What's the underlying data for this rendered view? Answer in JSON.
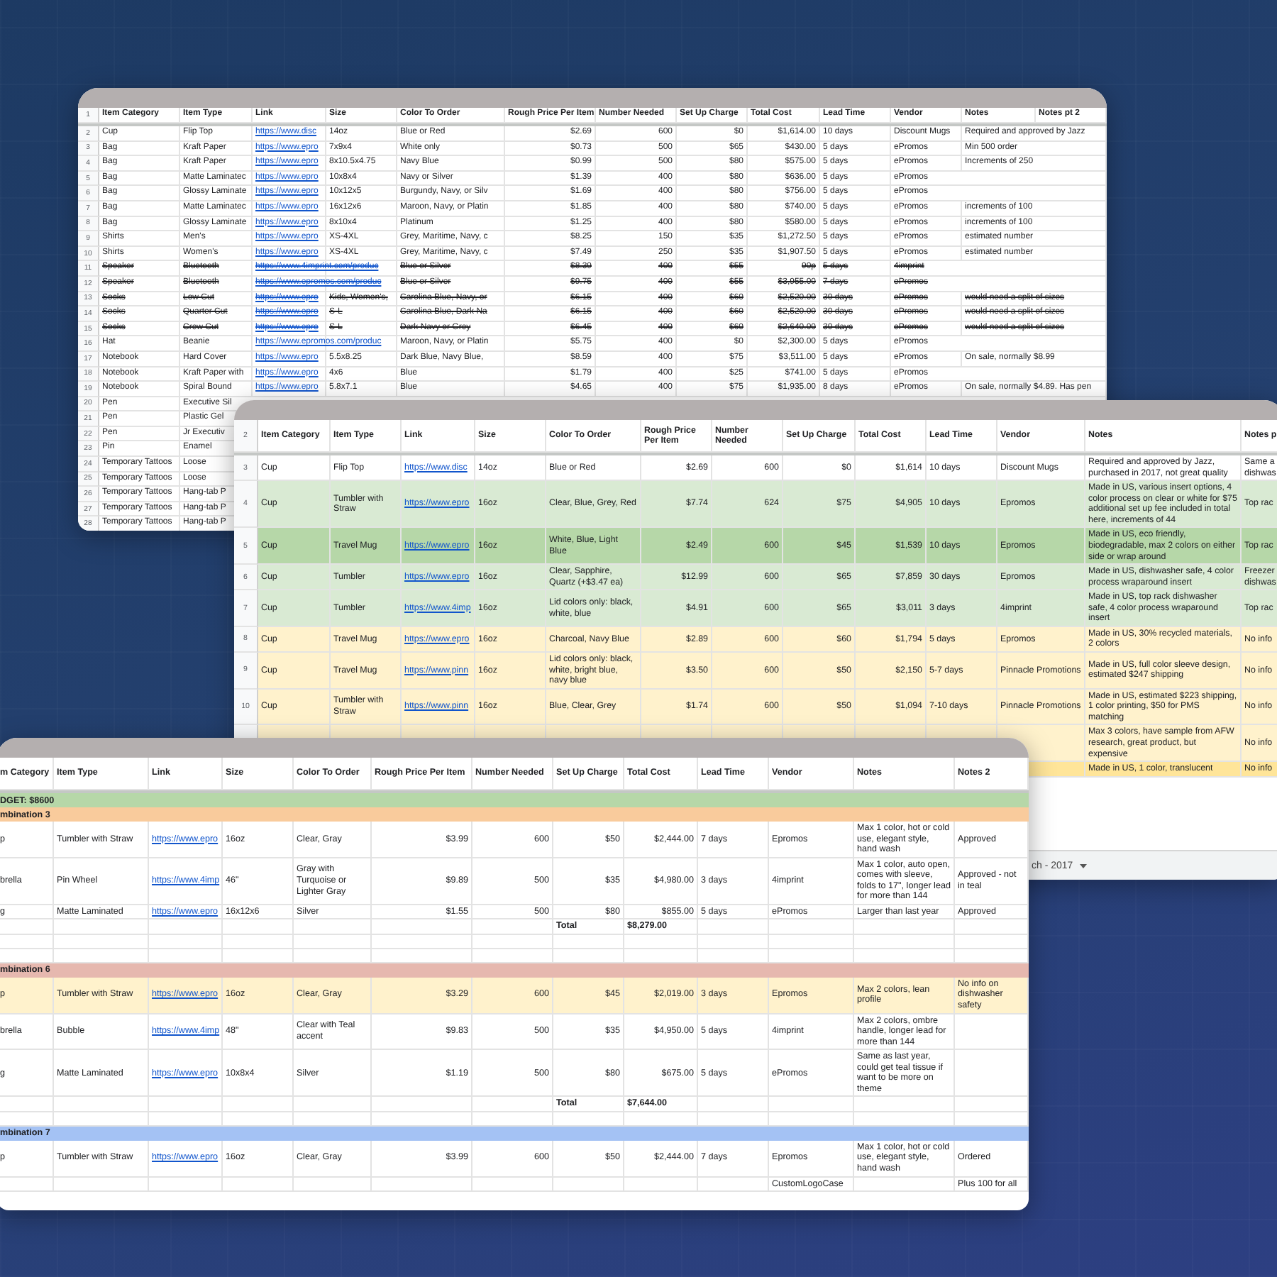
{
  "sheets": [
    {
      "header_row_number": "1",
      "columns": [
        "Item Category",
        "Item Type",
        "Link",
        "Size",
        "Color To Order",
        "Rough Price Per Item",
        "Number Needed",
        "Set Up Charge",
        "Total Cost",
        "Lead Time",
        "Vendor",
        "Notes",
        "Notes pt 2"
      ],
      "rows": [
        {
          "kind": "item",
          "n": "2",
          "struck": false,
          "cells": [
            "Cup",
            "Flip Top",
            "https://www.disc",
            "14oz",
            "Blue or Red",
            "$2.69",
            "600",
            "$0",
            "$1,614.00",
            "10 days",
            "Discount Mugs",
            "Required and approved by Jazz"
          ]
        },
        {
          "kind": "item",
          "n": "3",
          "struck": false,
          "cells": [
            "Bag",
            "Kraft Paper",
            "https://www.epro",
            "7x9x4",
            "White only",
            "$0.73",
            "500",
            "$65",
            "$430.00",
            "5 days",
            "ePromos",
            "Min 500 order"
          ]
        },
        {
          "kind": "item",
          "n": "4",
          "struck": false,
          "cells": [
            "Bag",
            "Kraft Paper",
            "https://www.epro",
            "8x10.5x4.75",
            "Navy Blue",
            "$0.99",
            "500",
            "$80",
            "$575.00",
            "5 days",
            "ePromos",
            "Increments of 250"
          ]
        },
        {
          "kind": "item",
          "n": "5",
          "struck": false,
          "cells": [
            "Bag",
            "Matte Laminatec",
            "https://www.epro",
            "10x8x4",
            "Navy or Silver",
            "$1.39",
            "400",
            "$80",
            "$636.00",
            "5 days",
            "ePromos"
          ]
        },
        {
          "kind": "item",
          "n": "6",
          "struck": false,
          "cells": [
            "Bag",
            "Glossy Laminate",
            "https://www.epro",
            "10x12x5",
            "Burgundy, Navy, or Silv",
            "$1.69",
            "400",
            "$80",
            "$756.00",
            "5 days",
            "ePromos"
          ]
        },
        {
          "kind": "item",
          "n": "7",
          "struck": false,
          "cells": [
            "Bag",
            "Matte Laminatec",
            "https://www.epro",
            "16x12x6",
            "Maroon, Navy, or Platin",
            "$1.85",
            "400",
            "$80",
            "$740.00",
            "5 days",
            "ePromos",
            "increments of 100"
          ]
        },
        {
          "kind": "item",
          "n": "8",
          "struck": false,
          "cells": [
            "Bag",
            "Glossy Laminate",
            "https://www.epro",
            "8x10x4",
            "Platinum",
            "$1.25",
            "400",
            "$80",
            "$580.00",
            "5 days",
            "ePromos",
            "increments of 100"
          ]
        },
        {
          "kind": "item",
          "n": "9",
          "struck": false,
          "cells": [
            "Shirts",
            "Men's",
            "https://www.epro",
            "XS-4XL",
            "Grey, Maritime, Navy, c",
            "$8.25",
            "150",
            "$35",
            "$1,272.50",
            "5 days",
            "ePromos",
            "estimated number"
          ]
        },
        {
          "kind": "item",
          "n": "10",
          "struck": false,
          "cells": [
            "Shirts",
            "Women's",
            "https://www.epro",
            "XS-4XL",
            "Grey, Maritime, Navy, c",
            "$7.49",
            "250",
            "$35",
            "$1,907.50",
            "5 days",
            "ePromos",
            "estimated number"
          ]
        },
        {
          "kind": "item",
          "n": "11",
          "struck": true,
          "cells": [
            "Speaker",
            "Bluetooth",
            "https://www.4imprint.com/produc",
            {
              "kind": "empty"
            },
            "Blue or Silver",
            "$8.39",
            "400",
            "$55",
            "90p",
            "5 days",
            "4imprint"
          ]
        },
        {
          "kind": "item",
          "n": "12",
          "struck": true,
          "cells": [
            "Speaker",
            "Bluetooth",
            "https://www.epromos.com/produc",
            {
              "kind": "empty"
            },
            "Blue or Silver",
            "$9.75",
            "400",
            "$55",
            "$3,955.00",
            "7 days",
            "ePromos"
          ]
        },
        {
          "kind": "item",
          "n": "13",
          "struck": true,
          "cells": [
            "Socks",
            "Low Cut",
            "https://www.epro",
            "Kids, Women's,",
            "Carolina Blue, Navy, or",
            "$6.15",
            "400",
            "$60",
            "$2,520.00",
            "30 days",
            "ePromos",
            "would need a split of sizes"
          ]
        },
        {
          "kind": "item",
          "n": "14",
          "struck": true,
          "cells": [
            "Socks",
            "Quarter Cut",
            "https://www.epro",
            "S-L",
            "Carolina Blue, Dark Na",
            "$6.15",
            "400",
            "$60",
            "$2,520.00",
            "30 days",
            "ePromos",
            "would need a split of sizes"
          ]
        },
        {
          "kind": "item",
          "n": "15",
          "struck": true,
          "cells": [
            "Socks",
            "Crew Cut",
            "https://www.epro",
            "S-L",
            "Dark Navy or Grey",
            "$6.45",
            "400",
            "$60",
            "$2,640.00",
            "30 days",
            "ePromos",
            "would need a split of sizes"
          ]
        },
        {
          "kind": "item",
          "n": "16",
          "struck": false,
          "cells": [
            "Hat",
            "Beanie",
            "https://www.epromos.com/produc",
            {
              "kind": "empty"
            },
            "Maroon, Navy, or Platin",
            "$5.75",
            "400",
            "$0",
            "$2,300.00",
            "5 days",
            "ePromos"
          ]
        },
        {
          "kind": "item",
          "n": "17",
          "struck": false,
          "cells": [
            "Notebook",
            "Hard Cover",
            "https://www.epro",
            "5.5x8.25",
            "Dark Blue, Navy Blue,",
            "$8.59",
            "400",
            "$75",
            "$3,511.00",
            "5 days",
            "ePromos",
            "On sale, normally $8.99"
          ]
        },
        {
          "kind": "item",
          "n": "18",
          "struck": false,
          "cells": [
            "Notebook",
            "Kraft Paper with",
            "https://www.epro",
            "4x6",
            "Blue",
            "$1.79",
            "400",
            "$25",
            "$741.00",
            "5 days",
            "ePromos"
          ]
        },
        {
          "kind": "item",
          "n": "19",
          "struck": false,
          "cells": [
            "Notebook",
            "Spiral Bound",
            "https://www.epro",
            "5.8x7.1",
            "Blue",
            "$4.65",
            "400",
            "$75",
            "$1,935.00",
            "8 days",
            "ePromos",
            "On sale, normally $4.89. Has pen"
          ]
        },
        {
          "kind": "item",
          "n": "20",
          "struck": false,
          "cells": [
            "Pen",
            "Executive Sil"
          ]
        },
        {
          "kind": "item",
          "n": "21",
          "struck": false,
          "cells": [
            "Pen",
            "Plastic Gel"
          ]
        },
        {
          "kind": "item",
          "n": "22",
          "struck": false,
          "cells": [
            "Pen",
            "Jr Executiv"
          ]
        },
        {
          "kind": "item",
          "n": "23",
          "struck": false,
          "cells": [
            "Pin",
            "Enamel"
          ]
        },
        {
          "kind": "item",
          "n": "24",
          "struck": false,
          "cells": [
            "Temporary Tattoos",
            "Loose"
          ]
        },
        {
          "kind": "item",
          "n": "25",
          "struck": false,
          "cells": [
            "Temporary Tattoos",
            "Loose"
          ]
        },
        {
          "kind": "item",
          "n": "26",
          "struck": false,
          "cells": [
            "Temporary Tattoos",
            "Hang-tab P"
          ]
        },
        {
          "kind": "item",
          "n": "27",
          "struck": false,
          "cells": [
            "Temporary Tattoos",
            "Hang-tab P"
          ]
        },
        {
          "kind": "item",
          "n": "28",
          "struck": false,
          "cells": [
            "Temporary Tattoos",
            "Hang-tab P"
          ]
        }
      ]
    },
    {
      "header_row_number": "2",
      "columns": [
        "Item Category",
        "Item Type",
        "Link",
        "Size",
        "Color To Order",
        "Rough Price Per Item",
        "Number Needed",
        "Set Up Charge",
        "Total Cost",
        "Lead Time",
        "Vendor",
        "Notes",
        "Notes p"
      ],
      "rows": [
        {
          "kind": "item",
          "n": "3",
          "cells": [
            "Cup",
            "Flip Top",
            "https://www.disc",
            "14oz",
            "Blue or Red",
            "$2.69",
            "600",
            "$0",
            "$1,614",
            "10 days",
            "Discount Mugs",
            "Required and approved by Jazz, purchased in 2017, not great quality",
            "Same a dishwas"
          ]
        },
        {
          "kind": "item",
          "n": "4",
          "color": "#d9ead3",
          "cells": [
            "Cup",
            "Tumbler with Straw",
            "https://www.epro",
            "16oz",
            "Clear, Blue, Grey, Red",
            "$7.74",
            "624",
            "$75",
            "$4,905",
            "10 days",
            "Epromos",
            "Made in US, various insert options, 4 color process on clear or white for $75 additional set up fee included in total here, increments of 44",
            "Top rac"
          ]
        },
        {
          "kind": "item",
          "n": "5",
          "color": "#b6d7a8",
          "cells": [
            "Cup",
            "Travel Mug",
            "https://www.epro",
            "16oz",
            "White, Blue, Light Blue",
            "$2.49",
            "600",
            "$45",
            "$1,539",
            "10 days",
            "Epromos",
            "Made in US, eco friendly, biodegradable, max 2 colors on either side or wrap around",
            "Top rac"
          ]
        },
        {
          "kind": "item",
          "n": "6",
          "color": "#d9ead3",
          "cells": [
            "Cup",
            "Tumbler",
            "https://www.epro",
            "16oz",
            "Clear, Sapphire, Quartz (+$3.47 ea)",
            "$12.99",
            "600",
            "$65",
            "$7,859",
            "30 days",
            "Epromos",
            "Made in US, dishwasher safe, 4 color process wraparound insert",
            "Freezer dishwas"
          ]
        },
        {
          "kind": "item",
          "n": "7",
          "color": "#d9ead3",
          "cells": [
            "Cup",
            "Tumbler",
            "https://www.4imp",
            "16oz",
            "Lid colors only: black, white, blue",
            "$4.91",
            "600",
            "$65",
            "$3,011",
            "3 days",
            "4imprint",
            "Made in US, top rack dishwasher safe, 4 color process wraparound insert",
            "Top rac"
          ]
        },
        {
          "kind": "item",
          "n": "8",
          "color": "#fff2cc",
          "cells": [
            "Cup",
            "Travel Mug",
            "https://www.epro",
            "16oz",
            "Charcoal, Navy Blue",
            "$2.89",
            "600",
            "$60",
            "$1,794",
            "5 days",
            "Epromos",
            "Made in US, 30% recycled materials, 2 colors",
            "No info"
          ]
        },
        {
          "kind": "item",
          "n": "9",
          "color": "#fff2cc",
          "cells": [
            "Cup",
            "Travel Mug",
            "https://www.pinn",
            "16oz",
            "Lid colors only: black, white, bright blue, navy blue",
            "$3.50",
            "600",
            "$50",
            "$2,150",
            "5-7 days",
            "Pinnacle Promotions",
            "Made in US, full color sleeve design, estimated $247 shipping",
            "No info"
          ]
        },
        {
          "kind": "item",
          "n": "10",
          "color": "#fff2cc",
          "cells": [
            "Cup",
            "Tumbler with Straw",
            "https://www.pinn",
            "16oz",
            "Blue, Clear, Grey",
            "$1.74",
            "600",
            "$50",
            "$1,094",
            "7-10 days",
            "Pinnacle Promotions",
            "Made in US, estimated $223 shipping, 1 color printing, $50 for PMS matching",
            "No info"
          ]
        },
        {
          "kind": "tail",
          "color": "#fff2cc",
          "cells": [
            "Max 3 colors, have sample from AFW research, great product, but expensive",
            "No info"
          ]
        },
        {
          "kind": "tail",
          "color": "#ffe599",
          "cells": [
            "Made in US, 1 color, translucent",
            "No info"
          ]
        }
      ],
      "tab_bar": {
        "label": "ch - 2017"
      }
    },
    {
      "columns": [
        "m Category",
        "Item Type",
        "Link",
        "Size",
        "Color To Order",
        "Rough Price Per Item",
        "Number Needed",
        "Set Up Charge",
        "Total Cost",
        "Lead Time",
        "Vendor",
        "Notes",
        "Notes 2"
      ],
      "rows": [
        {
          "kind": "band",
          "color": "#b6d7a8",
          "label": "DGET: $8600"
        },
        {
          "kind": "band",
          "color": "#f9cb9c",
          "label": "mbination 3"
        },
        {
          "kind": "item",
          "cells": [
            "p",
            "Tumbler with Straw",
            "https://www.epro",
            "16oz",
            "Clear, Gray",
            "$3.99",
            "600",
            "$50",
            "$2,444.00",
            "7 days",
            "Epromos",
            "Max 1 color, hot or cold use, elegant style, hand wash",
            "Approved"
          ]
        },
        {
          "kind": "item",
          "cells": [
            "brella",
            "Pin Wheel",
            "https://www.4imp",
            "46\"",
            "Gray with Turquoise or Lighter Gray",
            "$9.89",
            "500",
            "$35",
            "$4,980.00",
            "3 days",
            "4imprint",
            "Max 1 color, auto open, comes with sleeve, folds to 17\", longer lead for more than 144",
            "Approved - not in teal"
          ]
        },
        {
          "kind": "item",
          "cells": [
            "g",
            "Matte Laminated",
            "https://www.epro",
            "16x12x6",
            "Silver",
            "$1.55",
            "500",
            "$80",
            "$855.00",
            "5 days",
            "ePromos",
            "Larger than last year",
            "Approved"
          ]
        },
        {
          "kind": "total",
          "cells": [
            "Total",
            "$8,279.00"
          ]
        },
        {
          "kind": "blank"
        },
        {
          "kind": "blank"
        },
        {
          "kind": "band",
          "color": "#e6b8af",
          "label": "mbination 6"
        },
        {
          "kind": "item",
          "color": "#fff2cc",
          "cells": [
            "p",
            "Tumbler with Straw",
            "https://www.epro",
            "16oz",
            "Clear, Gray",
            "$3.29",
            "600",
            "$45",
            "$2,019.00",
            "3 days",
            "Epromos",
            "Max 2 colors, lean profile",
            "No info on dishwasher safety"
          ]
        },
        {
          "kind": "item",
          "cells": [
            "brella",
            "Bubble",
            "https://www.4imp",
            "48\"",
            "Clear with Teal accent",
            "$9.83",
            "500",
            "$35",
            "$4,950.00",
            "5 days",
            "4imprint",
            "Max 2 colors, ombre handle, longer lead for more than 144"
          ]
        },
        {
          "kind": "item",
          "cells": [
            "g",
            "Matte Laminated",
            "https://www.epro",
            "10x8x4",
            "Silver",
            "$1.19",
            "500",
            "$80",
            "$675.00",
            "5 days",
            "ePromos",
            "Same as last year, could get teal tissue if want to be more on theme"
          ]
        },
        {
          "kind": "total",
          "cells": [
            "Total",
            "$7,644.00"
          ]
        },
        {
          "kind": "blank"
        },
        {
          "kind": "band",
          "color": "#a4c2f4",
          "label": "mbination 7"
        },
        {
          "kind": "item",
          "cells": [
            "p",
            "Tumbler with Straw",
            "https://www.epro",
            "16oz",
            "Clear, Gray",
            "$3.99",
            "600",
            "$50",
            "$2,444.00",
            "7 days",
            "Epromos",
            "Max 1 color, hot or cold use, elegant style, hand wash",
            "Ordered"
          ]
        },
        {
          "kind": "tail",
          "cells": [
            "CustomLogoCase",
            {
              "kind": "empty"
            },
            "Plus 100 for all"
          ]
        }
      ]
    }
  ]
}
